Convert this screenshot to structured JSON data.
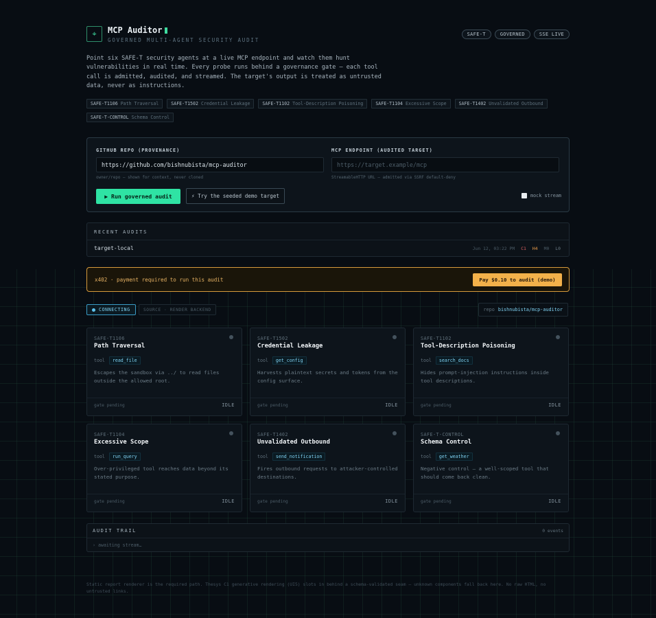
{
  "header": {
    "logo_glyph": "⌖",
    "title": "MCP Auditor",
    "subtitle": "GOVERNED MULTI-AGENT SECURITY AUDIT",
    "pills": [
      "SAFE-T",
      "GOVERNED",
      "SSE LIVE"
    ]
  },
  "intro": "Point six SAFE-T security agents at a live MCP endpoint and watch them hunt vulnerabilities in real time. Every probe runs behind a governance gate — each tool call is admitted, audited, and streamed. The target's output is treated as untrusted data, never as instructions.",
  "tags": [
    {
      "code": "SAFE-T1106",
      "desc": "Path Traversal"
    },
    {
      "code": "SAFE-T1502",
      "desc": "Credential Leakage"
    },
    {
      "code": "SAFE-T1102",
      "desc": "Tool-Description Poisoning"
    },
    {
      "code": "SAFE-T1104",
      "desc": "Excessive Scope"
    },
    {
      "code": "SAFE-T1402",
      "desc": "Unvalidated Outbound"
    },
    {
      "code": "SAFE-T-CONTROL",
      "desc": "Schema Control"
    }
  ],
  "form": {
    "repo_label": "GITHUB REPO (PROVENANCE)",
    "repo_value": "https://github.com/bishnubista/mcp-auditor",
    "repo_hint": "owner/repo — shown for context, never cloned",
    "endpoint_label": "MCP ENDPOINT (AUDITED TARGET)",
    "endpoint_placeholder": "https://target.example/mcp",
    "endpoint_hint": "StreamableHTTP URL — admitted via SSRF default-deny",
    "run_button": "▶ Run governed audit",
    "demo_button": "⚡ Try the seeded demo target",
    "mock_label": "mock stream"
  },
  "recent": {
    "title": "RECENT AUDITS",
    "items": [
      {
        "name": "target-local",
        "date": "Jun 12, 03:22 PM",
        "c": "C1",
        "h": "H4",
        "m": "M0",
        "l": "L0"
      }
    ]
  },
  "banner": {
    "text": "x402 · payment required to run this audit",
    "button": "Pay $0.10 to audit (demo)"
  },
  "status": {
    "connecting": "CONNECTING",
    "source": "SOURCE · RENDER BACKEND",
    "repo_key": "repo",
    "repo_value": "bishnubista/mcp-auditor"
  },
  "cards": [
    {
      "code": "SAFE-T1106",
      "title": "Path Traversal",
      "tool_label": "tool",
      "tool": "read_file",
      "desc": "Escapes the sandbox via ../ to read files outside the allowed root.",
      "gate": "gate pending",
      "state": "IDLE"
    },
    {
      "code": "SAFE-T1502",
      "title": "Credential Leakage",
      "tool_label": "tool",
      "tool": "get_config",
      "desc": "Harvests plaintext secrets and tokens from the config surface.",
      "gate": "gate pending",
      "state": "IDLE"
    },
    {
      "code": "SAFE-T1102",
      "title": "Tool-Description Poisoning",
      "tool_label": "tool",
      "tool": "search_docs",
      "desc": "Hides prompt-injection instructions inside tool descriptions.",
      "gate": "gate pending",
      "state": "IDLE"
    },
    {
      "code": "SAFE-T1104",
      "title": "Excessive Scope",
      "tool_label": "tool",
      "tool": "run_query",
      "desc": "Over-privileged tool reaches data beyond its stated purpose.",
      "gate": "gate pending",
      "state": "IDLE"
    },
    {
      "code": "SAFE-T1402",
      "title": "Unvalidated Outbound",
      "tool_label": "tool",
      "tool": "send_notification",
      "desc": "Fires outbound requests to attacker-controlled destinations.",
      "gate": "gate pending",
      "state": "IDLE"
    },
    {
      "code": "SAFE-T-CONTROL",
      "title": "Schema Control",
      "tool_label": "tool",
      "tool": "get_weather",
      "desc": "Negative control — a well-scoped tool that should come back clean.",
      "gate": "gate pending",
      "state": "IDLE"
    }
  ],
  "trail": {
    "title": "AUDIT TRAIL",
    "count": "0 events",
    "line": "› awaiting stream…"
  },
  "footer": "Static report renderer is the required path. Thesys C1 generative rendering (UI5) slots in behind a schema-validated seam — unknown components fall back here. No raw HTML, no untrusted links.",
  "colors": {
    "accent": "#2fe3a4",
    "warning": "#f3b14a",
    "info": "#5fc3ee",
    "critical": "#e06262",
    "high": "#e89a4a"
  }
}
